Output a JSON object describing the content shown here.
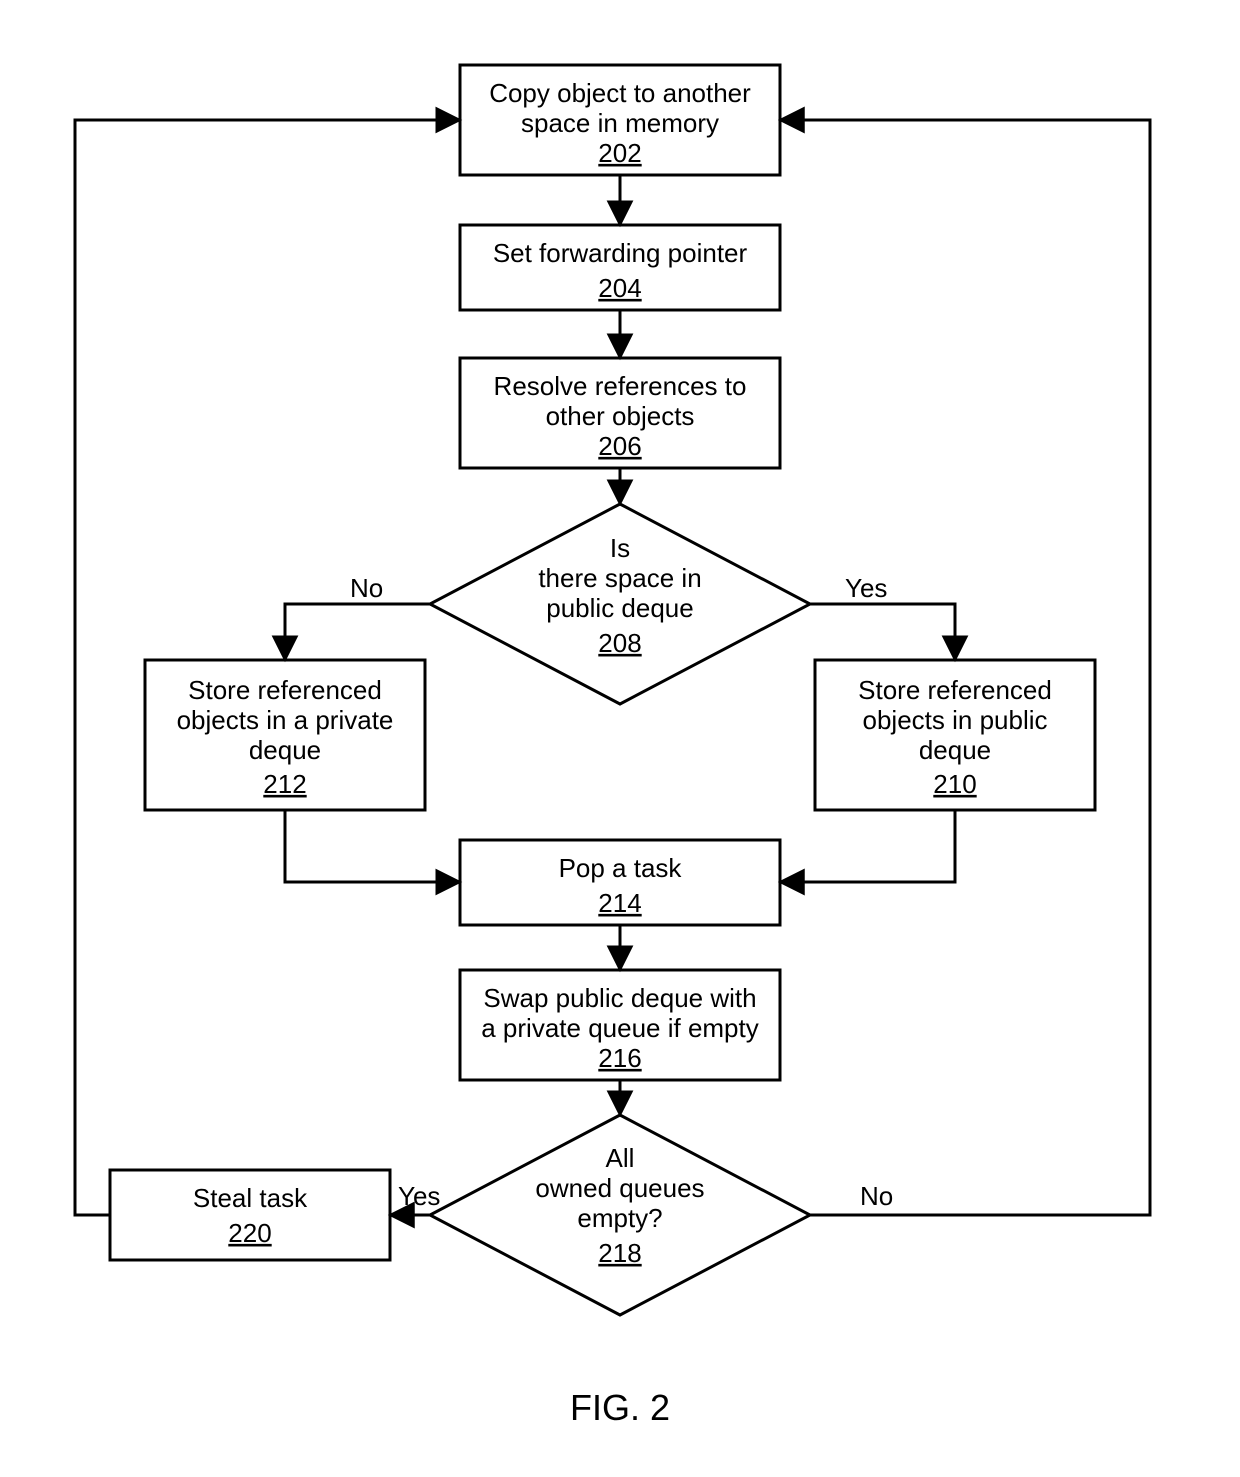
{
  "caption": "FIG. 2",
  "nodes": {
    "n202": {
      "line1": "Copy object to another",
      "line2": "space in memory",
      "ref": "202"
    },
    "n204": {
      "line1": "Set forwarding pointer",
      "ref": "204"
    },
    "n206": {
      "line1": "Resolve references to",
      "line2": "other objects",
      "ref": "206"
    },
    "n208": {
      "line1": "Is",
      "line2": "there space in",
      "line3": "public deque",
      "ref": "208"
    },
    "n210": {
      "line1": "Store referenced",
      "line2": "objects in public",
      "line3": "deque",
      "ref": "210"
    },
    "n212": {
      "line1": "Store referenced",
      "line2": "objects in a private",
      "line3": "deque",
      "ref": "212"
    },
    "n214": {
      "line1": "Pop a task",
      "ref": "214"
    },
    "n216": {
      "line1": "Swap public deque with",
      "line2": "a private queue if empty",
      "ref": "216"
    },
    "n218": {
      "line1": "All",
      "line2": "owned queues",
      "line3": "empty?",
      "ref": "218"
    },
    "n220": {
      "line1": "Steal task",
      "ref": "220"
    }
  },
  "labels": {
    "no1": "No",
    "yes1": "Yes",
    "no2": "No",
    "yes2": "Yes"
  }
}
